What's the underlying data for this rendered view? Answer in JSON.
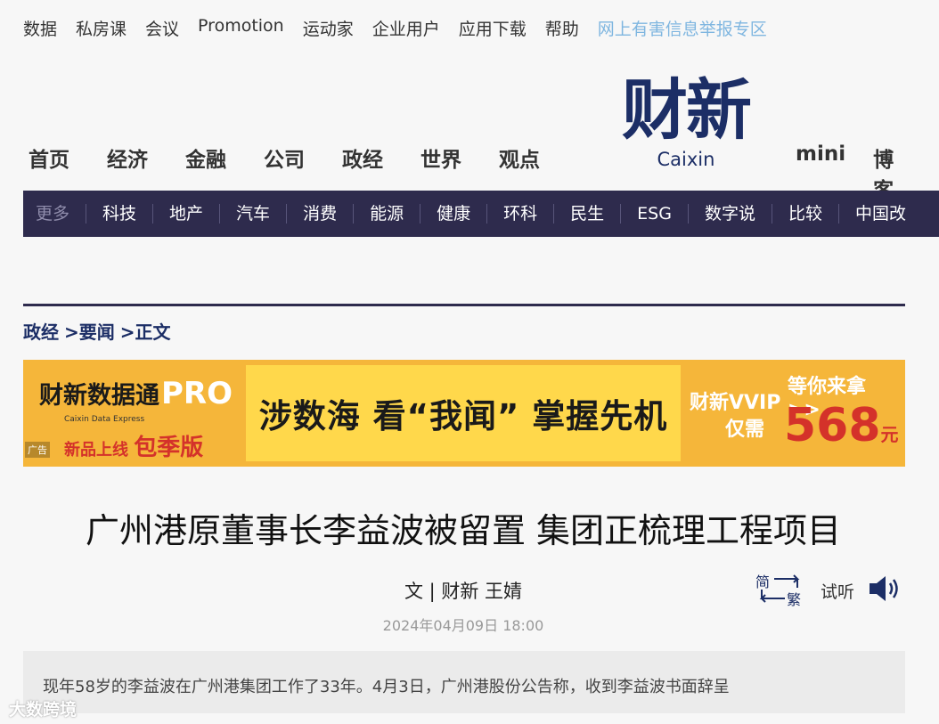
{
  "topbar": {
    "items": [
      "数据",
      "私房课",
      "会议",
      "Promotion",
      "运动家",
      "企业用户",
      "应用下载",
      "帮助"
    ],
    "report_link": "网上有害信息举报专区"
  },
  "logo": {
    "cn": "财新",
    "en": "Caixin"
  },
  "main_nav": {
    "items": [
      "首页",
      "经济",
      "金融",
      "公司",
      "政经",
      "世界",
      "观点"
    ],
    "right_items": [
      "mini",
      "博客"
    ]
  },
  "sub_nav": {
    "more_label": "更多",
    "items": [
      "科技",
      "地产",
      "汽车",
      "消费",
      "能源",
      "健康",
      "环科",
      "民生",
      "ESG",
      "数字说",
      "比较",
      "中国改"
    ]
  },
  "breadcrumb": [
    "政经",
    ">要闻",
    ">正文"
  ],
  "ad": {
    "brand": "财新数据通",
    "brand_pro": "PRO",
    "brand_en": "Caixin Data Express",
    "launch": "新品上线",
    "launch_big": "包季版",
    "tag": "广告",
    "slogan": "涉数海 看“我闻” 掌握先机",
    "vvip_line1": "财新VVIP",
    "vvip_line2": "仅需",
    "wait": "等你来拿 >>",
    "price": "568",
    "price_unit": "元"
  },
  "article": {
    "headline": "广州港原董事长李益波被留置 集团正梳理工程项目",
    "byline": "文 | 财新 王婧",
    "date": "2024年04月09日 18:00",
    "summary": "现年58岁的李益波在广州港集团工作了33年。4月3日，广州港股份公告称，收到李益波书面辞呈"
  },
  "tools": {
    "convert_simplified": "简",
    "convert_traditional": "繁",
    "listen_label": "试听"
  },
  "watermark": "大数跨境",
  "colors": {
    "brand_navy": "#1c2e66",
    "subnav_bg": "#2e2b4d",
    "report_link": "#7fb6e0",
    "ad_orange": "#f5b63a",
    "ad_yellow": "#ffd84b",
    "ad_red": "#d4322a"
  }
}
